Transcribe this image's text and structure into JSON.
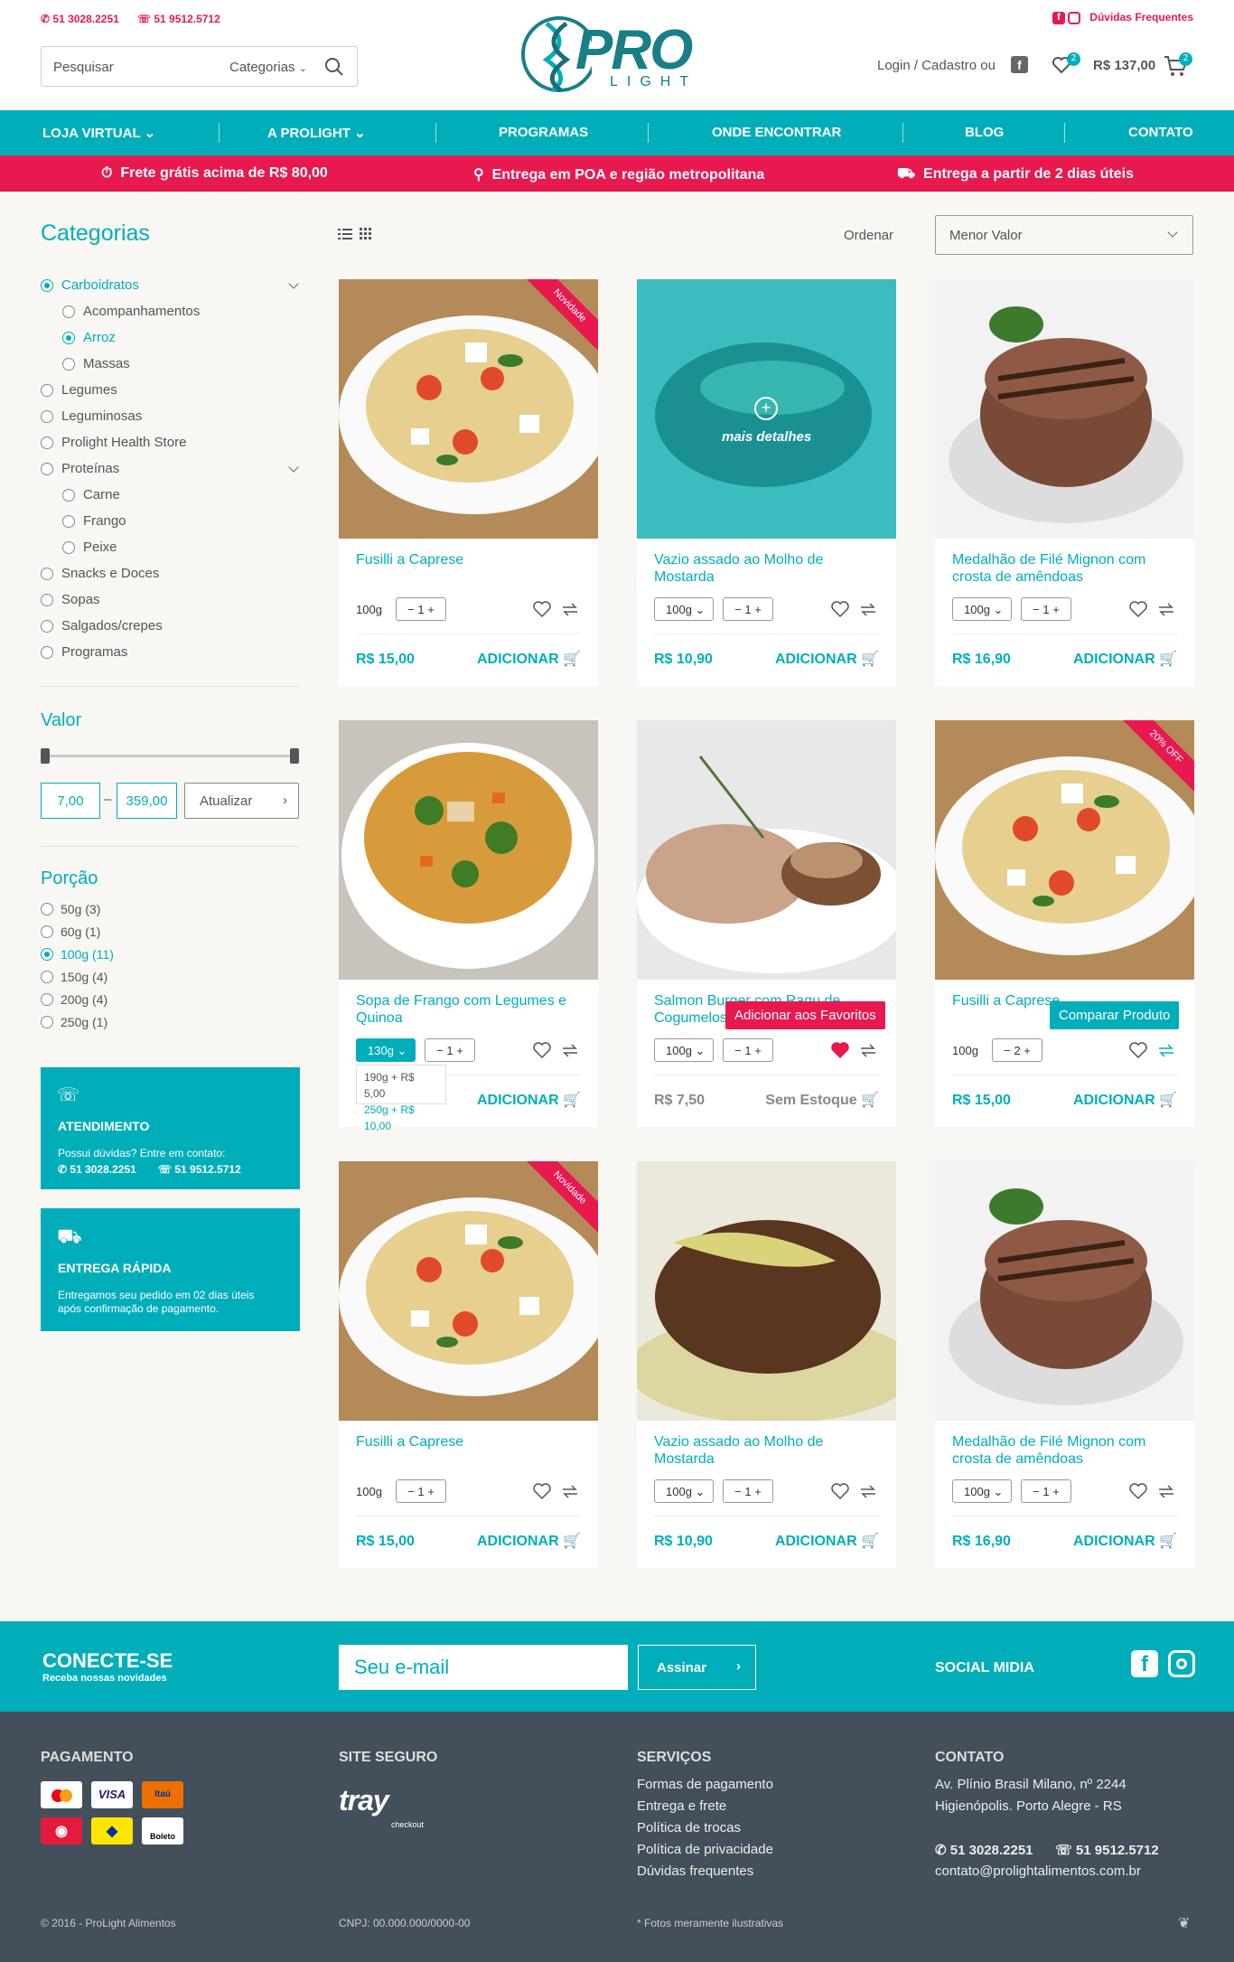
{
  "header": {
    "phone1": "51 3028.2251",
    "phone2": "51 9512.5712",
    "faq": "Dúvidas Frequentes",
    "search_placeholder": "Pesquisar",
    "search_category": "Categorias",
    "logo_text": "PRO",
    "logo_sub": "LIGHT",
    "login": "Login / Cadastro",
    "login_or": "ou",
    "fav_count": "2",
    "cart_total": "R$ 137,00",
    "cart_count": "2"
  },
  "nav": {
    "items": [
      "LOJA VIRTUAL",
      "A PROLIGHT",
      "PROGRAMAS",
      "ONDE ENCONTRAR",
      "BLOG",
      "CONTATO"
    ]
  },
  "promo": {
    "items": [
      "Frete grátis acima de R$ 80,00",
      "Entrega em POA e região metropolitana",
      "Entrega a partir de 2 dias úteis"
    ]
  },
  "sidebar": {
    "categories_title": "Categorias",
    "categories": [
      "Carboidratos",
      "Acompanhamentos",
      "Arroz",
      "Massas",
      "Legumes",
      "Leguminosas",
      "Prolight Health Store",
      "Proteínas",
      "Carne",
      "Frango",
      "Peixe",
      "Snacks e Doces",
      "Sopas",
      "Salgados/crepes",
      "Programas"
    ],
    "value_title": "Valor",
    "price_min": "7,00",
    "price_max": "359,00",
    "update_button": "Atualizar",
    "portion_title": "Porção",
    "portions": [
      "50g (3)",
      "60g (1)",
      "100g (11)",
      "150g (4)",
      "200g (4)",
      "250g (1)"
    ],
    "service_title": "ATENDIMENTO",
    "service_text": "Possui dúvidas? Entre em contato:",
    "service_phone1": "51 3028.2251",
    "service_phone2": "51 9512.5712",
    "delivery_title": "ENTREGA RÁPIDA",
    "delivery_text1": "Entregamos seu pedido em 02 dias úteis",
    "delivery_text2": "após confirmação de pagamento."
  },
  "toolbar": {
    "sort_label": "Ordenar",
    "sort_value": "Menor Valor"
  },
  "products": [
    {
      "name": "Fusilli a Caprese",
      "size": "100g",
      "qty": "1",
      "price": "R$ 15,00",
      "action": "ADICIONAR",
      "ribbon": "Novidade"
    },
    {
      "name": "Vazio assado ao Molho de Mostarda",
      "size": "100g",
      "qty": "1",
      "price": "R$ 10,90",
      "action": "ADICIONAR",
      "overlay": "mais detalhes"
    },
    {
      "name": "Medalhão de Filé Mignon com crosta de amêndoas",
      "size": "100g",
      "qty": "1",
      "price": "R$ 16,90",
      "action": "ADICIONAR"
    },
    {
      "name": "Sopa de Frango com Legumes e Quinoa",
      "size": "130g",
      "qty": "1",
      "price": "",
      "action": "ADICIONAR",
      "dropdown": [
        "190g + R$ 5,00",
        "250g + R$ 10,00"
      ]
    },
    {
      "name": "Salmon Burger com Ragu de Cogumelos",
      "size": "100g",
      "qty": "1",
      "price": "R$ 7,50",
      "action": "Sem Estoque",
      "tooltip": "Adicionar aos Favoritos"
    },
    {
      "name": "Fusilli a Caprese",
      "size": "100g",
      "qty": "2",
      "price": "R$ 15,00",
      "action": "ADICIONAR",
      "ribbon": "20% OFF",
      "tooltip": "Comparar Produto"
    },
    {
      "name": "Fusilli a Caprese",
      "size": "100g",
      "qty": "1",
      "price": "R$ 15,00",
      "action": "ADICIONAR",
      "ribbon": "Novidade"
    },
    {
      "name": "Vazio assado ao Molho de Mostarda",
      "size": "100g",
      "qty": "1",
      "price": "R$ 10,90",
      "action": "ADICIONAR"
    },
    {
      "name": "Medalhão de Filé Mignon com crosta de amêndoas",
      "size": "100g",
      "qty": "1",
      "price": "R$ 16,90",
      "action": "ADICIONAR"
    }
  ],
  "newsletter": {
    "title": "CONECTE-SE",
    "subtitle": "Receba nossas novidades",
    "placeholder": "Seu e-mail",
    "button": "Assinar",
    "social": "SOCIAL MIDIA"
  },
  "footer": {
    "payment_title": "PAGAMENTO",
    "payment_icons": [
      "Itaú",
      "Boleto"
    ],
    "secure_title": "SITE SEGURO",
    "secure_logo": "tray",
    "secure_sub": "checkout",
    "services_title": "SERVIÇOS",
    "services": [
      "Formas de pagamento",
      "Entrega e frete",
      "Política de trocas",
      "Política de privacidade",
      "Dúvidas frequentes"
    ],
    "contact_title": "CONTATO",
    "address1": "Av. Plínio Brasil Milano, nº 2244",
    "address2": "Higienópolis. Porto Alegre - RS",
    "phone1": "51 3028.2251",
    "phone2": "51 9512.5712",
    "email": "contato@prolightalimentos.com.br",
    "copyright": "© 2016 - ProLight Alimentos",
    "cnpj": "CNPJ: 00.000.000/0000-00",
    "disclaimer": "* Fotos meramente ilustrativas"
  }
}
